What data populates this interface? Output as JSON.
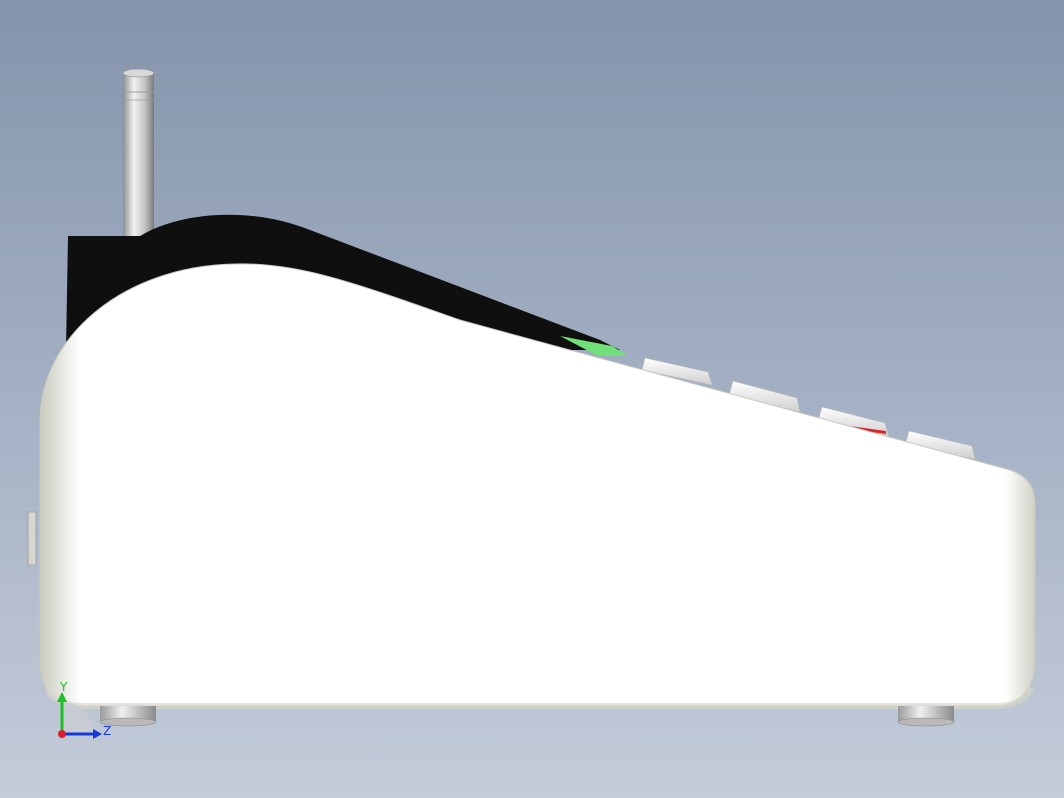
{
  "viewport": {
    "background_top": "#8594ab",
    "background_bottom": "#c4ccd9",
    "view": "side view"
  },
  "triad": {
    "y_label": "Y",
    "z_label": "Z",
    "y_color": "#1fbf2a",
    "z_color": "#1537d6",
    "x_color": "#d9202a"
  },
  "model": {
    "body_color": "#fdfdfd",
    "top_color": "#0d0d0d",
    "accent_green": "#6fe07a",
    "accent_red": "#d9262c",
    "antenna": "antenna-rod",
    "keys": [
      "key-1",
      "key-2",
      "key-3-red",
      "key-4"
    ],
    "feet": [
      "foot-left",
      "foot-right"
    ]
  }
}
